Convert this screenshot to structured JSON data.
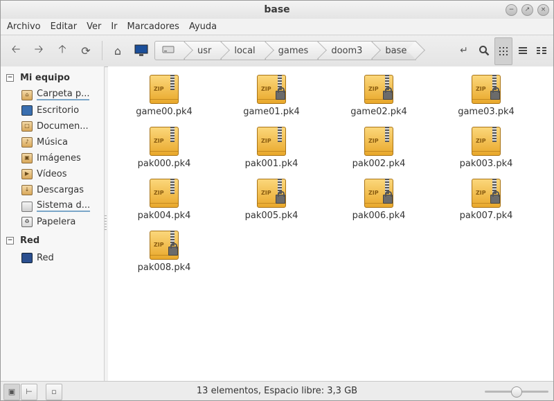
{
  "window": {
    "title": "base"
  },
  "menubar": [
    "Archivo",
    "Editar",
    "Ver",
    "Ir",
    "Marcadores",
    "Ayuda"
  ],
  "toolbar": {
    "icons": [
      "back-icon",
      "forward-icon",
      "up-icon",
      "reload-icon",
      "home-icon",
      "computer-icon",
      "drive-icon",
      "toggle-location-icon",
      "search-icon",
      "icon-view-icon",
      "list-view-icon",
      "compact-view-icon"
    ]
  },
  "breadcrumb": [
    "usr",
    "local",
    "games",
    "doom3",
    "base"
  ],
  "sidebar": {
    "sections": [
      {
        "title": "Mi equipo",
        "items": [
          {
            "label": "Carpeta p...",
            "icon": "home-folder-icon",
            "underline": true
          },
          {
            "label": "Escritorio",
            "icon": "desktop-icon"
          },
          {
            "label": "Documen...",
            "icon": "documents-folder-icon"
          },
          {
            "label": "Música",
            "icon": "music-folder-icon"
          },
          {
            "label": "Imágenes",
            "icon": "pictures-folder-icon"
          },
          {
            "label": "Vídeos",
            "icon": "videos-folder-icon"
          },
          {
            "label": "Descargas",
            "icon": "downloads-folder-icon"
          },
          {
            "label": "Sistema d...",
            "icon": "filesystem-icon",
            "underline": true
          },
          {
            "label": "Papelera",
            "icon": "trash-icon"
          }
        ]
      },
      {
        "title": "Red",
        "items": [
          {
            "label": "Red",
            "icon": "network-icon"
          }
        ]
      }
    ]
  },
  "files": [
    {
      "name": "game00.pk4",
      "locked": false
    },
    {
      "name": "game01.pk4",
      "locked": true
    },
    {
      "name": "game02.pk4",
      "locked": true
    },
    {
      "name": "game03.pk4",
      "locked": true
    },
    {
      "name": "pak000.pk4",
      "locked": false
    },
    {
      "name": "pak001.pk4",
      "locked": false
    },
    {
      "name": "pak002.pk4",
      "locked": false
    },
    {
      "name": "pak003.pk4",
      "locked": false
    },
    {
      "name": "pak004.pk4",
      "locked": false
    },
    {
      "name": "pak005.pk4",
      "locked": true
    },
    {
      "name": "pak006.pk4",
      "locked": true
    },
    {
      "name": "pak007.pk4",
      "locked": true
    },
    {
      "name": "pak008.pk4",
      "locked": true
    }
  ],
  "file_icon_text": "ZIP",
  "status": {
    "text": "13 elementos, Espacio libre: 3,3 GB",
    "zoom_fraction": 0.5
  },
  "colors": {
    "accent_underline": "#7aa6c8",
    "archive_icon": "#f0c050"
  }
}
